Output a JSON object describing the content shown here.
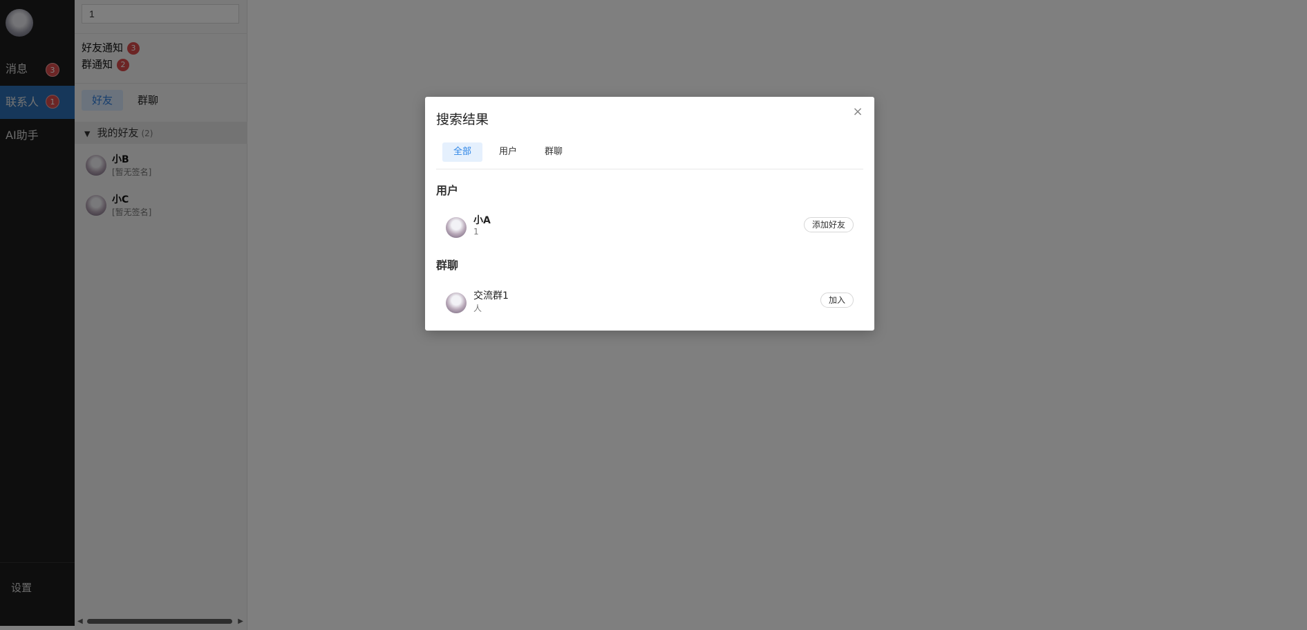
{
  "rail": {
    "items": [
      {
        "label": "消息",
        "badge": "3"
      },
      {
        "label": "联系人",
        "badge": "1"
      },
      {
        "label": "AI助手"
      }
    ],
    "settings_label": "设置"
  },
  "panel": {
    "search_value": "1",
    "notices": [
      {
        "label": "好友通知",
        "badge": "3"
      },
      {
        "label": "群通知",
        "badge": "2"
      }
    ],
    "tabs": [
      "好友",
      "群聊"
    ],
    "group": {
      "label": "我的好友",
      "count": "(2)"
    },
    "friends": [
      {
        "name": "小B",
        "signature": "[暂无签名]"
      },
      {
        "name": "小C",
        "signature": "[暂无签名]"
      }
    ]
  },
  "modal": {
    "title": "搜索结果",
    "close_symbol": "×",
    "tabs": [
      "全部",
      "用户",
      "群聊"
    ],
    "sections": {
      "users_title": "用户",
      "groups_title": "群聊"
    },
    "user_result": {
      "name": "小A",
      "sub": "1",
      "action": "添加好友"
    },
    "group_result": {
      "name": "交流群1",
      "sub": "人",
      "action": "加入"
    }
  },
  "colors": {
    "rail_bg": "#1d1d1d",
    "rail_active": "#2c6fb4",
    "badge": "#d84a4a",
    "tab_active_text": "#2f86e6"
  }
}
